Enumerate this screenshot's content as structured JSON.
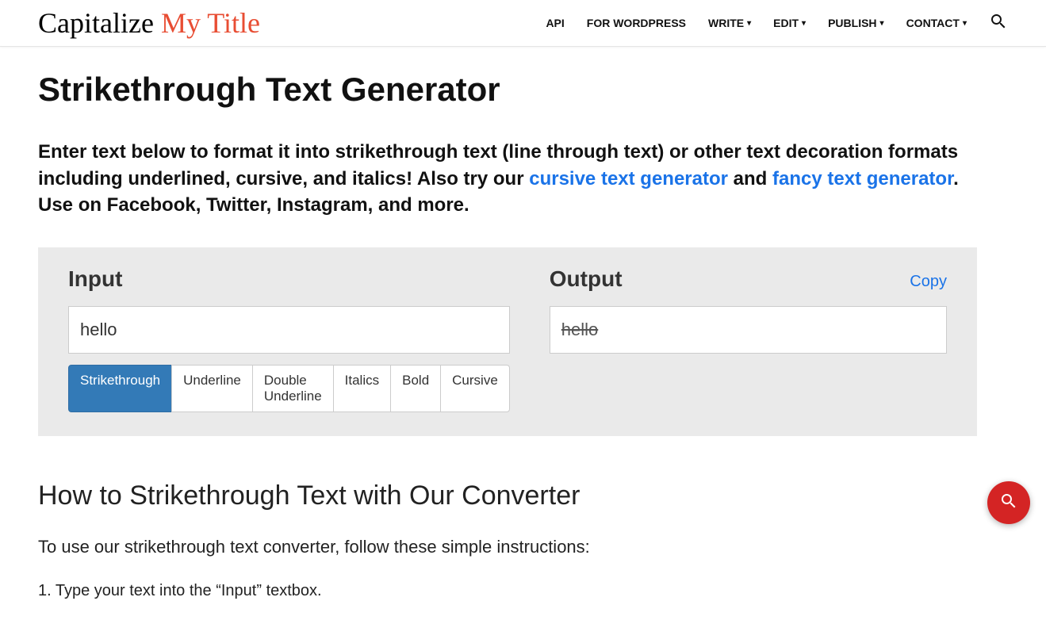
{
  "logo": {
    "part1": "Capitalize ",
    "part2": "My Title"
  },
  "nav": {
    "api": "API",
    "wordpress": "FOR WORDPRESS",
    "write": "WRITE",
    "edit": "EDIT",
    "publish": "PUBLISH",
    "contact": "CONTACT"
  },
  "page": {
    "title": "Strikethrough Text Generator",
    "intro_before": "Enter text below to format it into strikethrough text (line through text) or other text decoration formats including underlined, cursive, and italics! Also try our ",
    "link_cursive": "cursive text generator",
    "intro_and": " and ",
    "link_fancy": "fancy text generator",
    "intro_after": ". Use on Facebook, Twitter, Instagram, and more."
  },
  "tool": {
    "input_label": "Input",
    "output_label": "Output",
    "copy": "Copy",
    "input_value": "hello",
    "output_value": "hello ",
    "tabs": {
      "strikethrough": "Strikethrough",
      "underline": "Underline",
      "double_underline": "Double Underline",
      "italics": "Italics",
      "bold": "Bold",
      "cursive": "Cursive"
    }
  },
  "howto": {
    "title": "How to Strikethrough Text with Our Converter",
    "intro": "To use our strikethrough text converter, follow these simple instructions:",
    "step1": "1. Type your text into the “Input” textbox."
  }
}
